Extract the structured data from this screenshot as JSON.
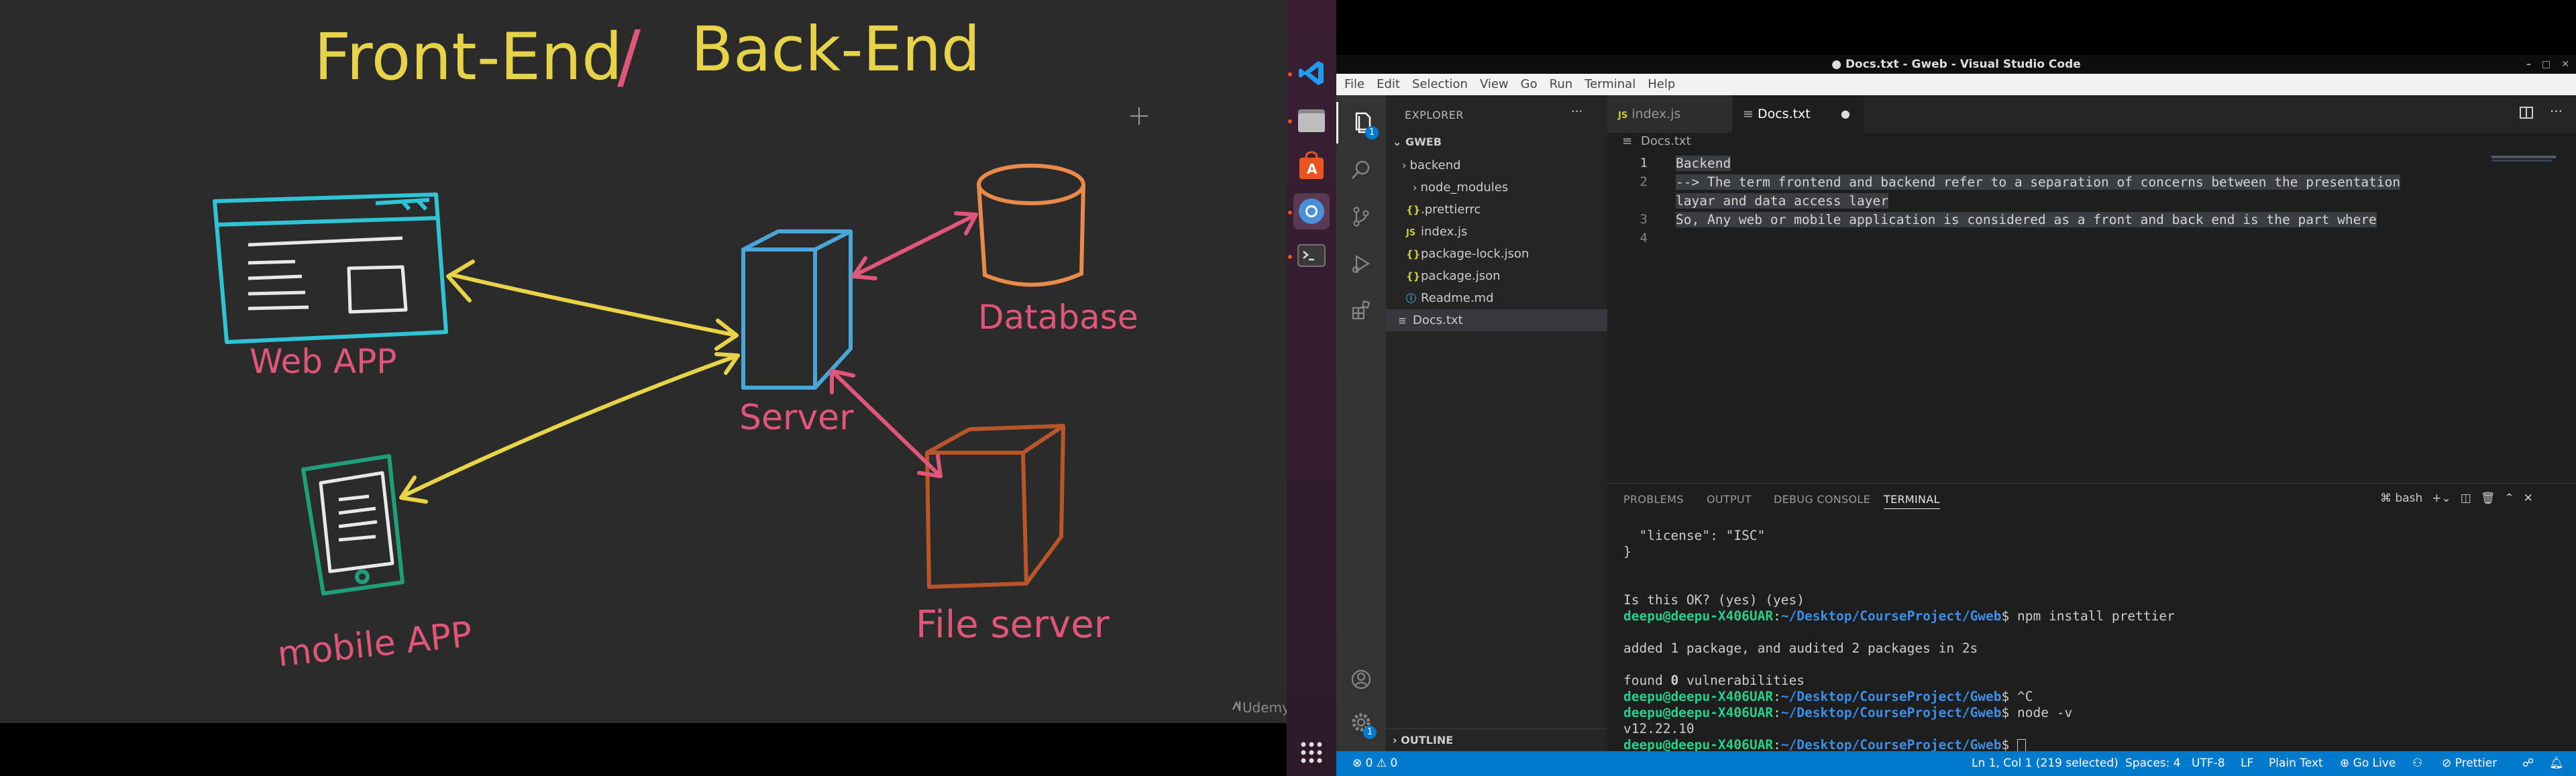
{
  "video": {
    "title_left": "Front-End",
    "title_sep": "/",
    "title_right": "Back-End",
    "web_app_label": "Web APP",
    "server_label": "Server",
    "database_label": "Database",
    "file_server_label": "File server",
    "mobile_app_label": "mobile APP",
    "watermark": "Udemy",
    "colors": {
      "bg": "#2b2b2b",
      "title": "#e6d34a",
      "accent": "#e0567a",
      "web_app": "#2ec4d6",
      "arrows": "#e9d447",
      "server": "#4aa6d6",
      "database": "#e98a4a",
      "file_server": "#b8562a",
      "mobile": "#1f9e7a"
    }
  },
  "dock": {
    "items": [
      {
        "name": "vscode-icon"
      },
      {
        "name": "files-icon"
      },
      {
        "name": "software-store-icon"
      },
      {
        "name": "chromium-icon"
      },
      {
        "name": "terminal-icon"
      },
      {
        "name": "show-apps-icon"
      }
    ]
  },
  "window": {
    "title": "● Docs.txt - Gweb - Visual Studio Code"
  },
  "menu": [
    "File",
    "Edit",
    "Selection",
    "View",
    "Go",
    "Run",
    "Terminal",
    "Help"
  ],
  "activity": {
    "explorer_badge": "1",
    "settings_badge": "1"
  },
  "sidebar": {
    "header": "EXPLORER",
    "more": "···",
    "root": "GWEB",
    "items": [
      {
        "label": "backend",
        "kind": "folder",
        "depth": 0
      },
      {
        "label": "node_modules",
        "kind": "folder",
        "depth": 1
      },
      {
        "label": ".prettierrc",
        "kind": "json",
        "depth": 0
      },
      {
        "label": "index.js",
        "kind": "js",
        "depth": 0
      },
      {
        "label": "package-lock.json",
        "kind": "json",
        "depth": 0
      },
      {
        "label": "package.json",
        "kind": "json",
        "depth": 0
      },
      {
        "label": "Readme.md",
        "kind": "info",
        "depth": 0
      },
      {
        "label": "Docs.txt",
        "kind": "txt",
        "depth": 0
      }
    ],
    "outline": "OUTLINE"
  },
  "editor": {
    "tabs": [
      {
        "label": "index.js",
        "icon": "JS",
        "active": false
      },
      {
        "label": "Docs.txt",
        "icon": "≡",
        "active": true
      }
    ],
    "breadcrumb": "Docs.txt",
    "line_numbers": [
      "1",
      "2",
      "3",
      "4"
    ],
    "lines": [
      "Backend",
      "--> The term frontend and backend refer to a separation of concerns between the presentation",
      "layar and data access layer",
      "So, Any web or mobile application is considered as a front and back end is the part where",
      ""
    ]
  },
  "panel": {
    "tabs": [
      "PROBLEMS",
      "OUTPUT",
      "DEBUG CONSOLE",
      "TERMINAL"
    ],
    "shell": "bash",
    "terminal": {
      "line1": "  \"license\": \"ISC\"",
      "line2": "}",
      "line3": "Is this OK? (yes) (yes)",
      "prompt_user": "deepu@deepu-X406UAR",
      "prompt_path": "~/Desktop/CourseProject/Gweb",
      "cmd1": "npm install prettier",
      "out1": "added 1 package, and audited 2 packages in 2s",
      "out2_a": "found ",
      "out2_b": "0",
      "out2_c": " vulnerabilities",
      "cmd2": "^C",
      "cmd3": "node -v",
      "out3": "v12.22.10"
    }
  },
  "status": {
    "problems": "⊗ 0 ⚠ 0",
    "position": "Ln 1, Col 1 (219 selected)",
    "spaces": "Spaces: 4",
    "encoding": "UTF-8",
    "eol": "LF",
    "language": "Plain Text",
    "live": "Go Live",
    "prettier": "Prettier"
  }
}
